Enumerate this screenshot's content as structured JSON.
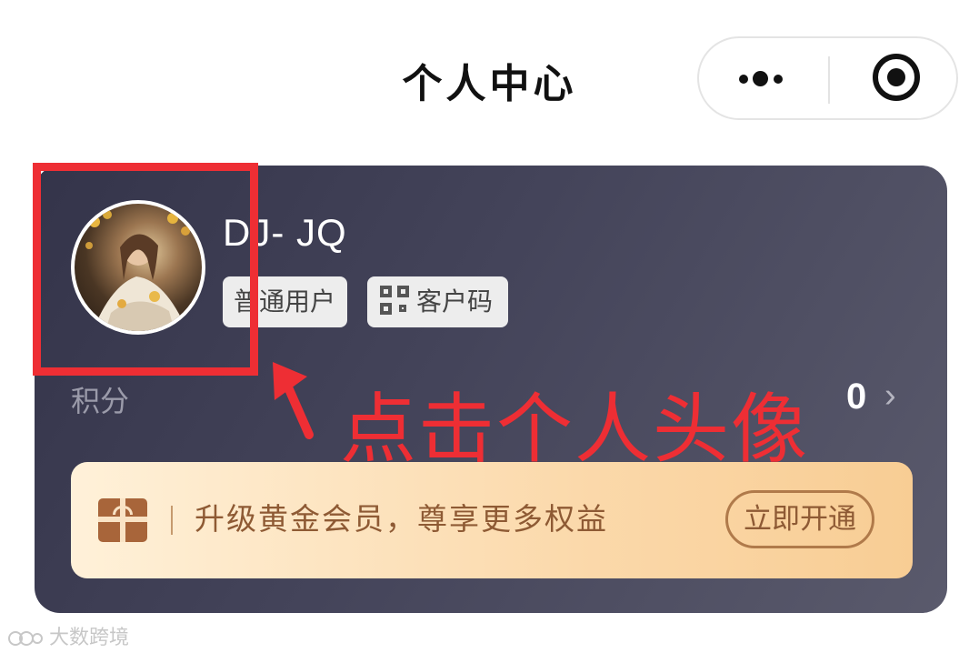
{
  "header": {
    "title": "个人中心",
    "more_icon": "more-dots-icon",
    "close_icon": "target-close-icon"
  },
  "profile": {
    "avatar_icon": "user-avatar",
    "username": "DJ- JQ",
    "level_tag": "普通用户",
    "qr_tag": "客户码",
    "qr_icon": "qr-code-icon"
  },
  "points": {
    "label": "积分",
    "value": "0",
    "chevron": "›"
  },
  "vip_banner": {
    "icon": "gift-icon",
    "text": "升级黄金会员，尊享更多权益",
    "button_label": "立即开通"
  },
  "annotation": {
    "text": "点击个人头像",
    "color": "#ee2e34"
  },
  "watermark": {
    "text": "大数跨境"
  },
  "colors": {
    "card_bg": "#3c3c50",
    "vip_gradient_start": "#fff1d9",
    "vip_gradient_end": "#f8cd94",
    "vip_text": "#8e5a34"
  }
}
